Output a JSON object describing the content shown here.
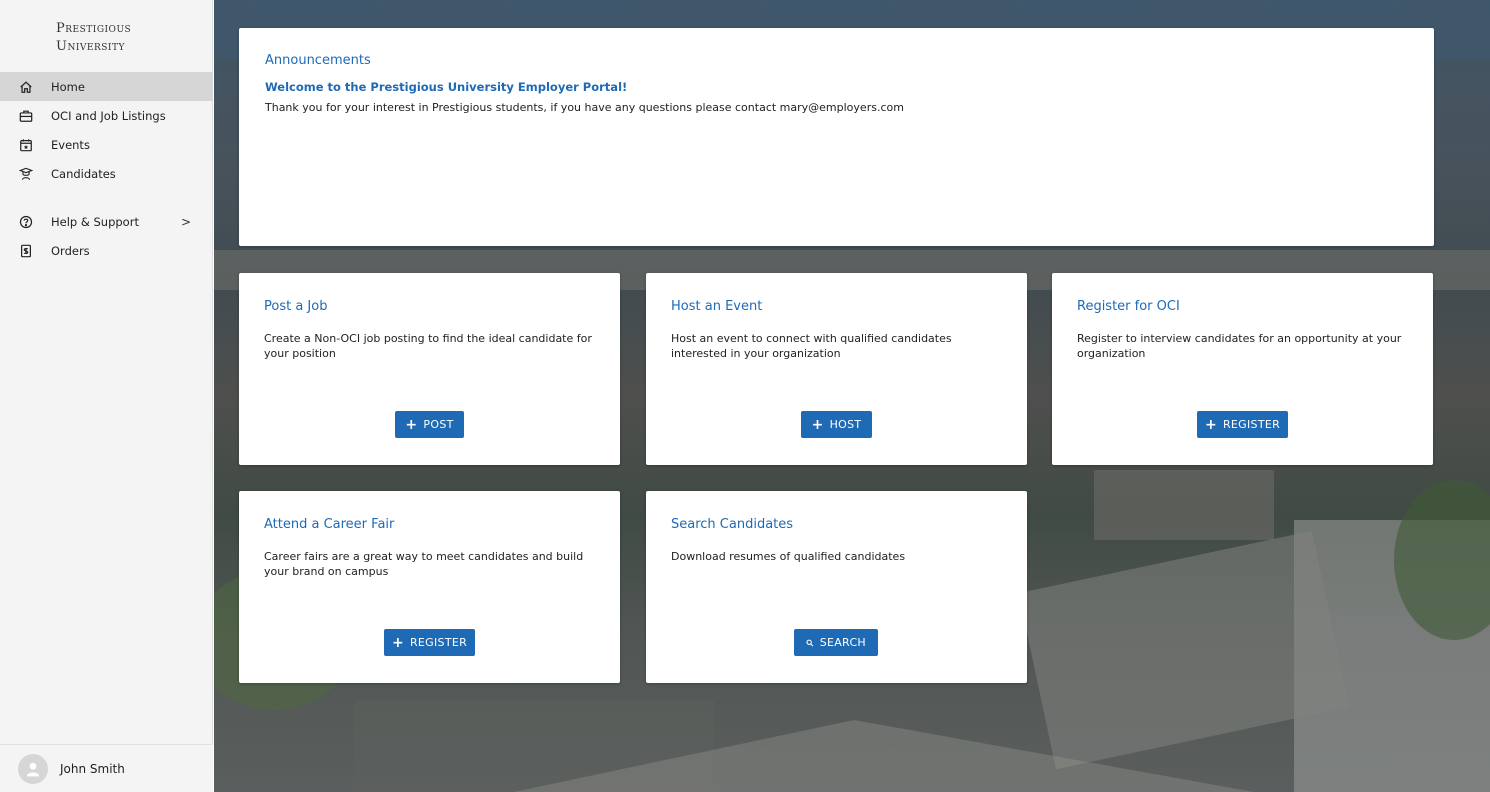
{
  "brand": {
    "logo_line1": "Prestigious",
    "logo_line2": "University"
  },
  "sidebar": {
    "items": [
      {
        "label": "Home",
        "icon": "home-icon",
        "active": true
      },
      {
        "label": "OCI and Job Listings",
        "icon": "briefcase-icon"
      },
      {
        "label": "Events",
        "icon": "calendar-icon"
      },
      {
        "label": "Candidates",
        "icon": "graduate-icon"
      },
      {
        "label": "Help & Support",
        "icon": "help-icon",
        "chevron": ">"
      },
      {
        "label": "Orders",
        "icon": "receipt-icon"
      }
    ]
  },
  "user": {
    "name": "John Smith"
  },
  "announcements": {
    "title": "Announcements",
    "headline": "Welcome to the Prestigious University Employer Portal!",
    "message": "Thank you for your interest in Prestigious students, if you have any questions please contact mary@employers.com"
  },
  "cards": {
    "post_job": {
      "title": "Post a Job",
      "description": "Create a Non-OCI job posting to find the ideal candidate for your position",
      "button": "POST"
    },
    "host_event": {
      "title": "Host an Event",
      "description": "Host an event to connect with qualified candidates interested in your organization",
      "button": "HOST"
    },
    "register_oci": {
      "title": "Register for OCI",
      "description": "Register to interview candidates for an opportunity at your organization",
      "button": "REGISTER"
    },
    "career_fair": {
      "title": "Attend a Career Fair",
      "description": "Career fairs are a great way to meet candidates and build your brand on campus",
      "button": "REGISTER"
    },
    "search_candidates": {
      "title": "Search Candidates",
      "description": "Download resumes of qualified candidates",
      "button": "SEARCH"
    }
  },
  "colors": {
    "accent": "#1f6ab5",
    "sidebar_bg": "#f4f4f4",
    "active_item_bg": "#d6d6d6"
  }
}
